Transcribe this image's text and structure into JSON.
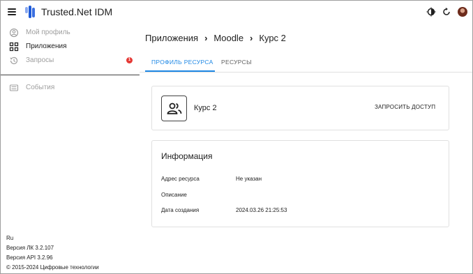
{
  "header": {
    "app_title": "Trusted.Net IDM"
  },
  "sidebar": {
    "items": [
      {
        "label": "Мой профиль",
        "icon": "account-circle-icon"
      },
      {
        "label": "Приложения",
        "icon": "apps-grid-icon"
      },
      {
        "label": "Запросы",
        "icon": "history-icon",
        "badge": "1"
      },
      {
        "label": "События",
        "icon": "list-icon"
      }
    ]
  },
  "footer": {
    "lang": "Ru",
    "lk_version": "Версия ЛК 3.2.107",
    "api_version": "Версия API 3.2.96",
    "copyright": "© 2015-2024 Цифровые технологии"
  },
  "breadcrumb": {
    "items": [
      "Приложения",
      "Moodle",
      "Курс 2"
    ]
  },
  "tabs": [
    {
      "label": "ПРОФИЛЬ РЕСУРСА",
      "active": true
    },
    {
      "label": "РЕСУРСЫ",
      "active": false
    }
  ],
  "resource": {
    "name": "Курс 2",
    "request_button": "ЗАПРОСИТЬ ДОСТУП"
  },
  "info": {
    "title": "Информация",
    "rows": [
      {
        "label": "Адрес ресурса",
        "value": "Не указан"
      },
      {
        "label": "Описание",
        "value": ""
      },
      {
        "label": "Дата создания",
        "value": "2024.03.26 21:25:53"
      }
    ]
  },
  "colors": {
    "accent": "#1e88e5",
    "badge": "#e53935",
    "logo": "#1e5bd8"
  }
}
